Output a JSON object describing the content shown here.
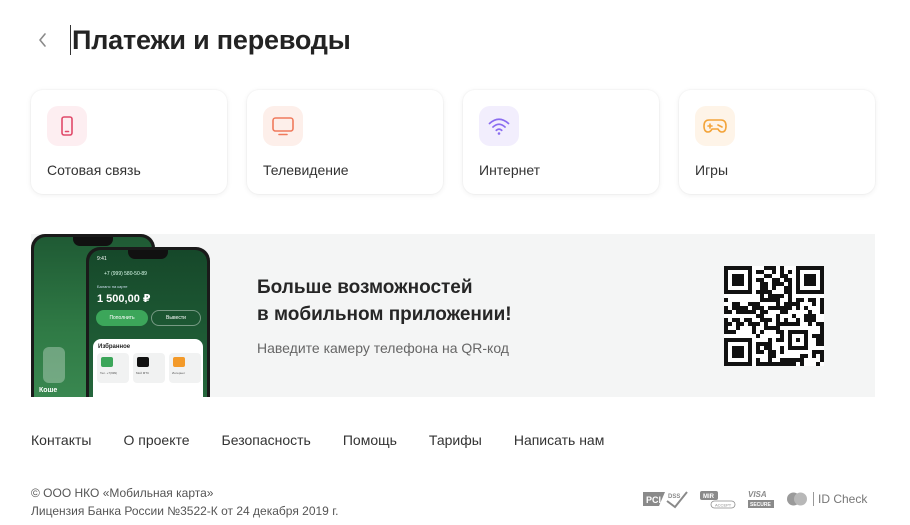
{
  "header": {
    "title": "Платежи и переводы"
  },
  "categories": [
    {
      "label": "Сотовая связь",
      "icon": "mobile-phone-icon",
      "color": "#e04a6a",
      "bg": "#fdeef1"
    },
    {
      "label": "Телевидение",
      "icon": "tv-icon",
      "color": "#f07a5c",
      "bg": "#fdefea"
    },
    {
      "label": "Интернет",
      "icon": "wifi-icon",
      "color": "#8a6cf0",
      "bg": "#f2eefd"
    },
    {
      "label": "Игры",
      "icon": "gamepad-icon",
      "color": "#f3a43a",
      "bg": "#fef4e8"
    }
  ],
  "promo": {
    "title_line1": "Больше возможностей",
    "title_line2": "в мобильном приложении!",
    "subtitle": "Наведите камеру телефона на QR-код",
    "phone": {
      "time": "9:41",
      "phone_number": "+7 (999) 580-50-89",
      "balance_label": "Баланс на карте",
      "balance": "1 500,00 ₽",
      "btn_topup": "Пополнить",
      "btn_transfer": "Вывести",
      "favorites_title": "Избранное",
      "favorites": [
        "Тел. +7(999)",
        "Мой МТС",
        "Интернет"
      ],
      "back_text": "Коше"
    }
  },
  "footer": {
    "links": [
      "Контакты",
      "О проекте",
      "Безопасность",
      "Помощь",
      "Тарифы",
      "Написать нам"
    ],
    "copyright": "© ООО НКО «Мобильная карта»",
    "license": "Лицензия Банка России №3522-К от 24 декабря 2019 г.",
    "payment_badges": {
      "pci": "PCI",
      "dss": "DSS",
      "mir": "MIR",
      "mir_sub": "ACCEPT",
      "visa": "VISA",
      "visa_sub": "SECURE",
      "idcheck": "ID Check"
    }
  },
  "colors": {
    "accent_green": "#2f7a45",
    "text_primary": "#232323",
    "promo_bg": "#f4f5f5"
  }
}
